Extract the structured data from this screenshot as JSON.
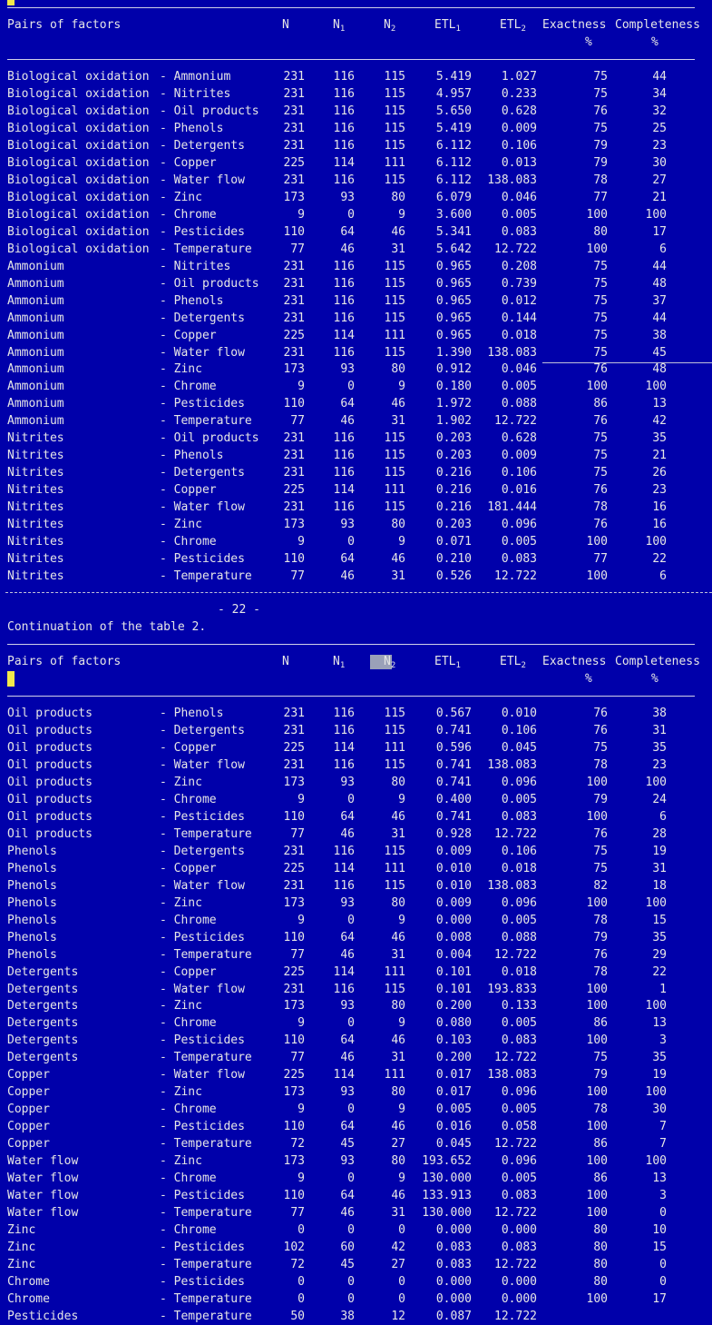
{
  "header": {
    "pairs": "Pairs of factors",
    "n": "N",
    "n1_base": "N",
    "n1_sub": "1",
    "n2_base": "N",
    "n2_sub": "2",
    "etl1_base": "ETL",
    "etl1_sub": "1",
    "etl2_base": "ETL",
    "etl2_sub": "2",
    "exactness": "Exactness",
    "completeness": "Completeness",
    "pct": "%"
  },
  "page_footer": "- 22 -",
  "continuation": "Continuation of the table 2.",
  "top_rows": [
    [
      "Biological oxidation",
      "- Ammonium",
      "231",
      "116",
      "115",
      "5.419",
      "1.027",
      "75",
      "44"
    ],
    [
      "Biological oxidation",
      "- Nitrites",
      "231",
      "116",
      "115",
      "4.957",
      "0.233",
      "75",
      "34"
    ],
    [
      "Biological oxidation",
      "- Oil products",
      "231",
      "116",
      "115",
      "5.650",
      "0.628",
      "76",
      "32"
    ],
    [
      "Biological oxidation",
      "- Phenols",
      "231",
      "116",
      "115",
      "5.419",
      "0.009",
      "75",
      "25"
    ],
    [
      "Biological oxidation",
      "- Detergents",
      "231",
      "116",
      "115",
      "6.112",
      "0.106",
      "79",
      "23"
    ],
    [
      "Biological oxidation",
      "- Copper",
      "225",
      "114",
      "111",
      "6.112",
      "0.013",
      "79",
      "30"
    ],
    [
      "Biological oxidation",
      "- Water flow",
      "231",
      "116",
      "115",
      "6.112",
      "138.083",
      "78",
      "27"
    ],
    [
      "Biological oxidation",
      "- Zinc",
      "173",
      "93",
      "80",
      "6.079",
      "0.046",
      "77",
      "21"
    ],
    [
      "Biological oxidation",
      "- Chrome",
      "9",
      "0",
      "9",
      "3.600",
      "0.005",
      "100",
      "100"
    ],
    [
      "Biological oxidation",
      "- Pesticides",
      "110",
      "64",
      "46",
      "5.341",
      "0.083",
      "80",
      "17"
    ],
    [
      "Biological oxidation",
      "- Temperature",
      "77",
      "46",
      "31",
      "5.642",
      "12.722",
      "100",
      "6"
    ],
    [
      "Ammonium",
      "- Nitrites",
      "231",
      "116",
      "115",
      "0.965",
      "0.208",
      "75",
      "44"
    ],
    [
      "Ammonium",
      "- Oil products",
      "231",
      "116",
      "115",
      "0.965",
      "0.739",
      "75",
      "48"
    ],
    [
      "Ammonium",
      "- Phenols",
      "231",
      "116",
      "115",
      "0.965",
      "0.012",
      "75",
      "37"
    ],
    [
      "Ammonium",
      "- Detergents",
      "231",
      "116",
      "115",
      "0.965",
      "0.144",
      "75",
      "44"
    ],
    [
      "Ammonium",
      "- Copper",
      "225",
      "114",
      "111",
      "0.965",
      "0.018",
      "75",
      "38"
    ],
    [
      "Ammonium",
      "- Water flow",
      "231",
      "116",
      "115",
      "1.390",
      "138.083",
      "75",
      "45"
    ],
    [
      "Ammonium",
      "- Zinc",
      "173",
      "93",
      "80",
      "0.912",
      "0.046",
      "76",
      "48"
    ],
    [
      "Ammonium",
      "- Chrome",
      "9",
      "0",
      "9",
      "0.180",
      "0.005",
      "100",
      "100"
    ],
    [
      "Ammonium",
      "- Pesticides",
      "110",
      "64",
      "46",
      "1.972",
      "0.088",
      "86",
      "13"
    ],
    [
      "Ammonium",
      "- Temperature",
      "77",
      "46",
      "31",
      "1.902",
      "12.722",
      "76",
      "42"
    ],
    [
      "Nitrites",
      "- Oil products",
      "231",
      "116",
      "115",
      "0.203",
      "0.628",
      "75",
      "35"
    ],
    [
      "Nitrites",
      "- Phenols",
      "231",
      "116",
      "115",
      "0.203",
      "0.009",
      "75",
      "21"
    ],
    [
      "Nitrites",
      "- Detergents",
      "231",
      "116",
      "115",
      "0.216",
      "0.106",
      "75",
      "26"
    ],
    [
      "Nitrites",
      "- Copper",
      "225",
      "114",
      "111",
      "0.216",
      "0.016",
      "76",
      "23"
    ],
    [
      "Nitrites",
      "- Water flow",
      "231",
      "116",
      "115",
      "0.216",
      "181.444",
      "78",
      "16"
    ],
    [
      "Nitrites",
      "- Zinc",
      "173",
      "93",
      "80",
      "0.203",
      "0.096",
      "76",
      "16"
    ],
    [
      "Nitrites",
      "- Chrome",
      "9",
      "0",
      "9",
      "0.071",
      "0.005",
      "100",
      "100"
    ],
    [
      "Nitrites",
      "- Pesticides",
      "110",
      "64",
      "46",
      "0.210",
      "0.083",
      "77",
      "22"
    ],
    [
      "Nitrites",
      "- Temperature",
      "77",
      "46",
      "31",
      "0.526",
      "12.722",
      "100",
      "6"
    ]
  ],
  "bottom_rows": [
    [
      "Oil products",
      "- Phenols",
      "231",
      "116",
      "115",
      "0.567",
      "0.010",
      "76",
      "38"
    ],
    [
      "Oil products",
      "- Detergents",
      "231",
      "116",
      "115",
      "0.741",
      "0.106",
      "76",
      "31"
    ],
    [
      "Oil products",
      "- Copper",
      "225",
      "114",
      "111",
      "0.596",
      "0.045",
      "75",
      "35"
    ],
    [
      "Oil products",
      "- Water flow",
      "231",
      "116",
      "115",
      "0.741",
      "138.083",
      "78",
      "23"
    ],
    [
      "Oil products",
      "- Zinc",
      "173",
      "93",
      "80",
      "0.741",
      "0.096",
      "100",
      "100"
    ],
    [
      "Oil products",
      "- Chrome",
      "9",
      "0",
      "9",
      "0.400",
      "0.005",
      "79",
      "24"
    ],
    [
      "Oil products",
      "- Pesticides",
      "110",
      "64",
      "46",
      "0.741",
      "0.083",
      "100",
      "6"
    ],
    [
      "Oil products",
      "- Temperature",
      "77",
      "46",
      "31",
      "0.928",
      "12.722",
      "76",
      "28"
    ],
    [
      "Phenols",
      "- Detergents",
      "231",
      "116",
      "115",
      "0.009",
      "0.106",
      "75",
      "19"
    ],
    [
      "Phenols",
      "- Copper",
      "225",
      "114",
      "111",
      "0.010",
      "0.018",
      "75",
      "31"
    ],
    [
      "Phenols",
      "- Water flow",
      "231",
      "116",
      "115",
      "0.010",
      "138.083",
      "82",
      "18"
    ],
    [
      "Phenols",
      "- Zinc",
      "173",
      "93",
      "80",
      "0.009",
      "0.096",
      "100",
      "100"
    ],
    [
      "Phenols",
      "- Chrome",
      "9",
      "0",
      "9",
      "0.000",
      "0.005",
      "78",
      "15"
    ],
    [
      "Phenols",
      "- Pesticides",
      "110",
      "64",
      "46",
      "0.008",
      "0.088",
      "79",
      "35"
    ],
    [
      "Phenols",
      "- Temperature",
      "77",
      "46",
      "31",
      "0.004",
      "12.722",
      "76",
      "29"
    ],
    [
      "Detergents",
      "- Copper",
      "225",
      "114",
      "111",
      "0.101",
      "0.018",
      "78",
      "22"
    ],
    [
      "Detergents",
      "- Water flow",
      "231",
      "116",
      "115",
      "0.101",
      "193.833",
      "100",
      "1"
    ],
    [
      "Detergents",
      "- Zinc",
      "173",
      "93",
      "80",
      "0.200",
      "0.133",
      "100",
      "100"
    ],
    [
      "Detergents",
      "- Chrome",
      "9",
      "0",
      "9",
      "0.080",
      "0.005",
      "86",
      "13"
    ],
    [
      "Detergents",
      "- Pesticides",
      "110",
      "64",
      "46",
      "0.103",
      "0.083",
      "100",
      "3"
    ],
    [
      "Detergents",
      "- Temperature",
      "77",
      "46",
      "31",
      "0.200",
      "12.722",
      "75",
      "35"
    ],
    [
      "Copper",
      "- Water flow",
      "225",
      "114",
      "111",
      "0.017",
      "138.083",
      "79",
      "19"
    ],
    [
      "Copper",
      "- Zinc",
      "173",
      "93",
      "80",
      "0.017",
      "0.096",
      "100",
      "100"
    ],
    [
      "Copper",
      "- Chrome",
      "9",
      "0",
      "9",
      "0.005",
      "0.005",
      "78",
      "30"
    ],
    [
      "Copper",
      "- Pesticides",
      "110",
      "64",
      "46",
      "0.016",
      "0.058",
      "100",
      "7"
    ],
    [
      "Copper",
      "- Temperature",
      "72",
      "45",
      "27",
      "0.045",
      "12.722",
      "86",
      "7"
    ],
    [
      "Water flow",
      "- Zinc",
      "173",
      "93",
      "80",
      "193.652",
      "0.096",
      "100",
      "100"
    ],
    [
      "Water flow",
      "- Chrome",
      "9",
      "0",
      "9",
      "130.000",
      "0.005",
      "86",
      "13"
    ],
    [
      "Water flow",
      "- Pesticides",
      "110",
      "64",
      "46",
      "133.913",
      "0.083",
      "100",
      "3"
    ],
    [
      "Water flow",
      "- Temperature",
      "77",
      "46",
      "31",
      "130.000",
      "12.722",
      "100",
      "0"
    ],
    [
      "Zinc",
      "- Chrome",
      "0",
      "0",
      "0",
      "0.000",
      "0.000",
      "80",
      "10"
    ],
    [
      "Zinc",
      "- Pesticides",
      "102",
      "60",
      "42",
      "0.083",
      "0.083",
      "80",
      "15"
    ],
    [
      "Zinc",
      "- Temperature",
      "72",
      "45",
      "27",
      "0.083",
      "12.722",
      "80",
      "0"
    ],
    [
      "Chrome",
      "- Pesticides",
      "0",
      "0",
      "0",
      "0.000",
      "0.000",
      "80",
      "0"
    ],
    [
      "Chrome",
      "- Temperature",
      "0",
      "0",
      "0",
      "0.000",
      "0.000",
      "100",
      "17"
    ],
    [
      "Pesticides",
      "- Temperature",
      "50",
      "38",
      "12",
      "0.087",
      "12.722",
      "",
      ""
    ]
  ]
}
